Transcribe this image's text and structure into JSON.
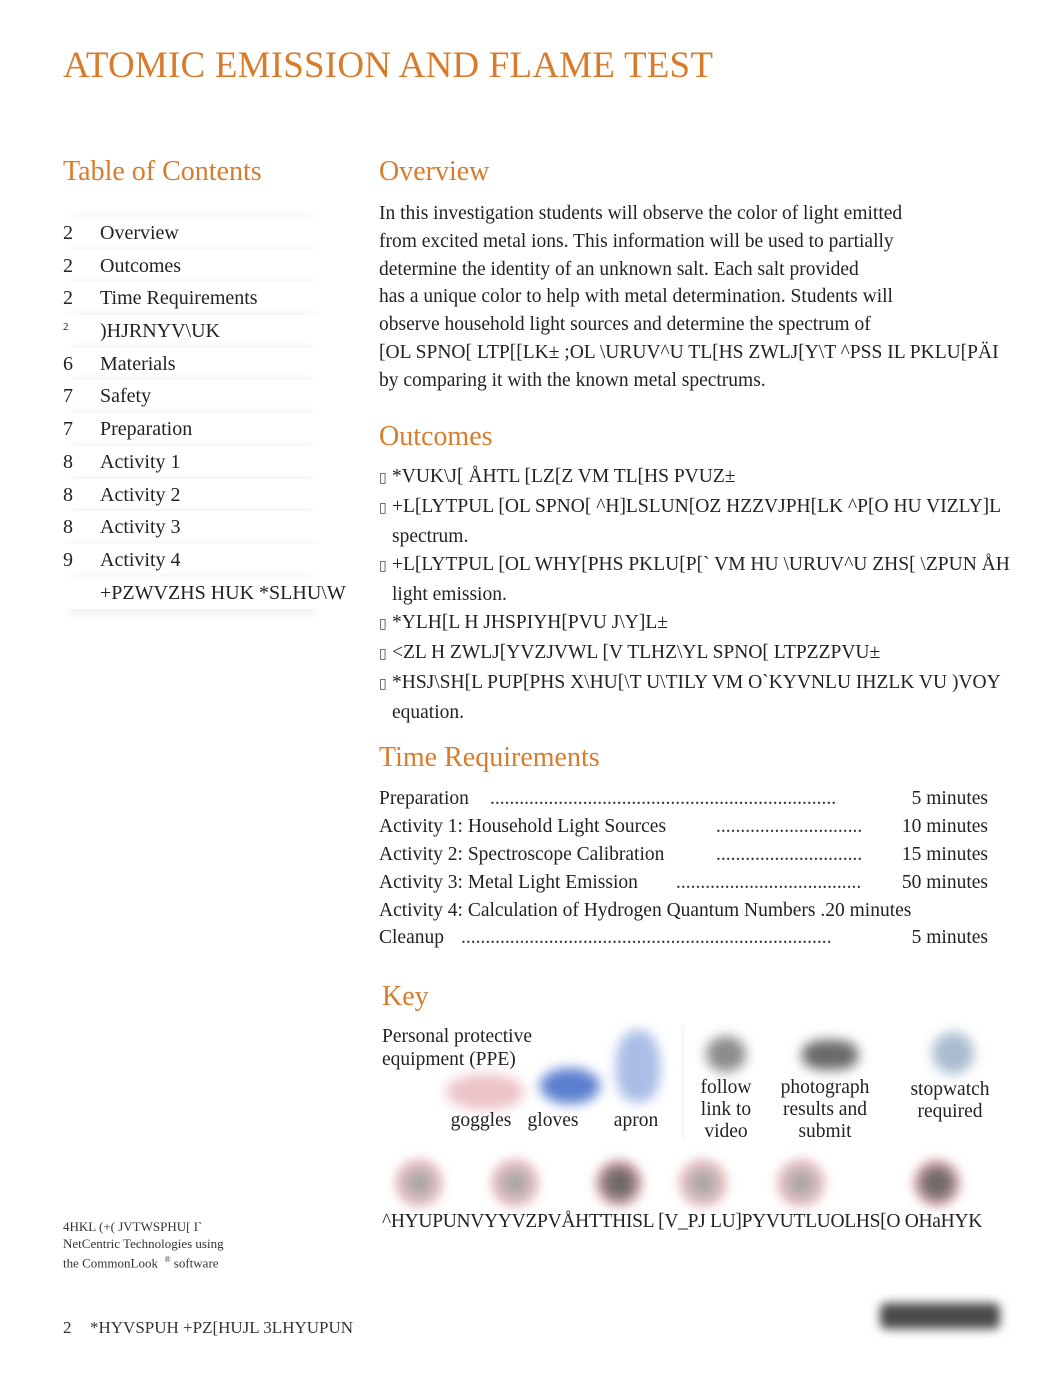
{
  "document": {
    "title": "ATOMIC EMISSION AND FLAME TEST",
    "accent_color": "#d87c2c"
  },
  "toc": {
    "heading": "Table of Contents",
    "items": [
      {
        "page": "2",
        "label": "Overview"
      },
      {
        "page": "2",
        "label": "Outcomes"
      },
      {
        "page": "2",
        "label": "Time Requirements"
      },
      {
        "page": "2",
        "label": ")HJRNYV\\UK"
      },
      {
        "page": "6",
        "label": "Materials"
      },
      {
        "page": "7",
        "label": "Safety"
      },
      {
        "page": "7",
        "label": "Preparation"
      },
      {
        "page": "8",
        "label": "Activity 1"
      },
      {
        "page": "8",
        "label": "Activity 2"
      },
      {
        "page": "8",
        "label": "Activity 3"
      },
      {
        "page": "9",
        "label": "Activity 4"
      },
      {
        "page": "",
        "label": "+PZWVZHS HUK *SLHU\\W"
      }
    ]
  },
  "overview": {
    "heading": "Overview",
    "lines": [
      "In this investigation students will observe the color of light emitted",
      "from excited metal ions. This information will be used to partially",
      "determine the identity of an unknown salt. Each salt provided",
      "has a unique color to help with metal determination. Students will",
      "observe household light sources and determine the spectrum of",
      "[OL SPNO[ LTP[[LK± ;OL \\URUV^U TL[HS ZWLJ[Y\\T ^PSS IL PKLU[PÄI",
      "by comparing it with the known metal spectrums."
    ]
  },
  "outcomes": {
    "heading": "Outcomes",
    "bullet_icon": "bullet-box-icon",
    "items": [
      {
        "text": "*VUK\\J[ ÅHTL [LZ[Z VM TL[HS PVUZ±",
        "cont": ""
      },
      {
        "text": "+L[LYTPUL [OL SPNO[ ^H]LSLUN[OZ HZZVJPH[LK ^P[O HU VIZLY]L",
        "cont": "spectrum."
      },
      {
        "text": "+L[LYTPUL [OL WHY[PHS PKLU[P[` VM HU \\URUV^U ZHS[ \\ZPUN ÅH",
        "cont": "light emission."
      },
      {
        "text": "*YLH[L H JHSPIYH[PVU J\\Y]L±",
        "cont": ""
      },
      {
        "text": "<ZL H ZWLJ[YVZJVWL [V TLHZ\\YL SPNO[ LTPZZPVU±",
        "cont": ""
      },
      {
        "text": "*HSJ\\SH[L PUP[PHS X\\HU[\\T U\\TILY VM O`KYVNLU IHZLK VU )VOY",
        "cont": "equation."
      }
    ]
  },
  "time_requirements": {
    "heading": "Time Requirements",
    "rows": [
      {
        "task": "Preparation",
        "dots": ".......................................................................",
        "duration": "5 minutes"
      },
      {
        "task": "Activity 1: Household Light Sources",
        "dots": "..............................",
        "duration": "10 minutes"
      },
      {
        "task": "Activity 2: Spectroscope Calibration",
        "dots": "..............................",
        "duration": "15 minutes"
      },
      {
        "task": "Activity 3: Metal Light Emission",
        "dots": "......................................",
        "duration": "50 minutes"
      },
      {
        "task": "Activity 4: Calculation of Hydrogen Quantum Numbers .20 minutes",
        "dots": "",
        "duration": ""
      },
      {
        "task": "Cleanup",
        "dots": "............................................................................",
        "duration": "5 minutes"
      }
    ]
  },
  "key": {
    "heading": "Key",
    "ppe_label": "Personal protective equipment (PPE)",
    "ppe_items": [
      {
        "icon": "goggles-icon",
        "label": "goggles"
      },
      {
        "icon": "gloves-icon",
        "label": "gloves"
      },
      {
        "icon": "apron-icon",
        "label": "apron"
      }
    ],
    "other_items": [
      {
        "icon": "video-link-icon",
        "label_lines": [
          "follow",
          "link to",
          "video"
        ]
      },
      {
        "icon": "camera-icon",
        "label_lines": [
          "photograph",
          "results and",
          "submit"
        ]
      },
      {
        "icon": "stopwatch-icon",
        "label_lines": [
          "stopwatch",
          "required"
        ]
      }
    ],
    "hazard_labels": "^HYUPUNVYYVZPVÅHTTHISL  [V_PJ LU]PYVUTLUOLHS[O OHaHYK"
  },
  "credit": {
    "line1": "4HKL (+( JVTWSPHU[ I`",
    "line2": "NetCentric Technologies using",
    "line3_pre": "the CommonLook",
    "line3_sup": "®",
    "line3_post": " software"
  },
  "footer": {
    "page_number": "2",
    "title": "*HYVSPUH +PZ[HUJL 3LHYUPUN"
  }
}
